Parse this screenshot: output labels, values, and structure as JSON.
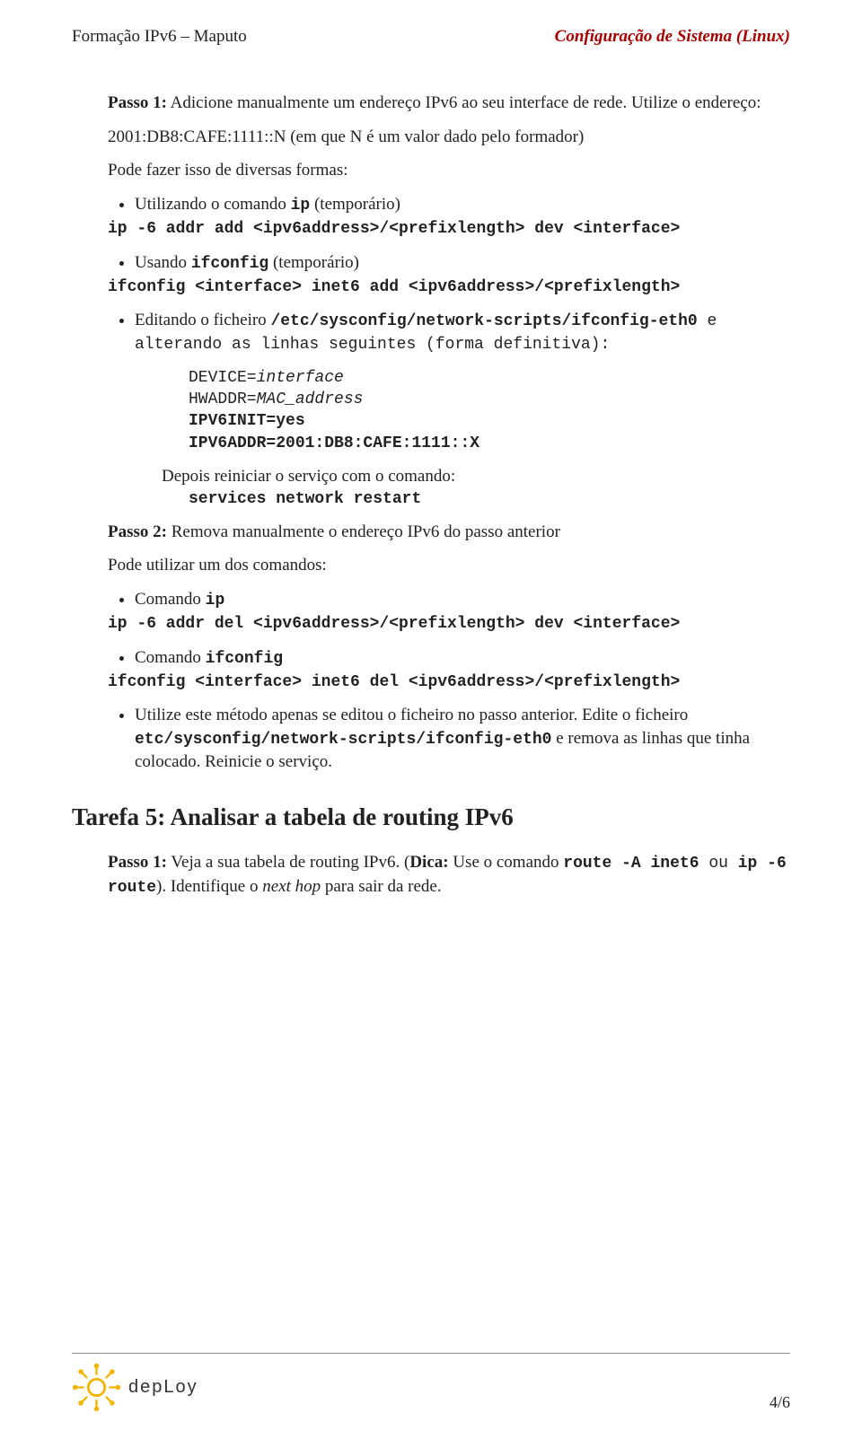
{
  "header": {
    "left": "Formação IPv6 – Maputo",
    "right": "Configuração de Sistema (Linux)"
  },
  "passo1": {
    "label": "Passo 1:",
    "title": " Adicione manualmente um endereço IPv6 ao seu interface de rede. Utilize o endereço:",
    "addr_line": "2001:DB8:CAFE:1111::N (em que N é um valor dado pelo formador)",
    "pode": "Pode fazer isso de diversas formas:",
    "b1_text_a": "Utilizando o comando ",
    "b1_code": "ip",
    "b1_text_b": " (temporário)",
    "b1_cmd": "ip -6 addr add <ipv6address>/<prefixlength> dev <interface>",
    "b2_text_a": "Usando ",
    "b2_code": "ifconfig",
    "b2_text_b": " (temporário)",
    "b2_cmd": "ifconfig <interface> inet6 add <ipv6address>/<prefixlength>",
    "b3_text_a": "Editando o ficheiro ",
    "b3_code": "/etc/sysconfig/network-scripts/ifconfig-eth0",
    "b3_text_b": " e alterando as linhas seguintes (forma definitiva):",
    "cb_l1a": "DEVICE=",
    "cb_l1b": "interface",
    "cb_l2a": "HWADDR=",
    "cb_l2b": "MAC_address",
    "cb_l3": "IPV6INIT=yes",
    "cb_l4": "IPV6ADDR=2001:DB8:CAFE:1111::X",
    "depois": "Depois reiniciar o serviço com o comando:",
    "depois_cmd": "services network restart"
  },
  "passo2": {
    "label": "Passo 2:",
    "title": " Remova manualmente o endereço IPv6 do passo anterior",
    "pode": "Pode utilizar um dos comandos:",
    "b1_text": "Comando ",
    "b1_code": "ip",
    "b1_cmd": "ip -6 addr del <ipv6address>/<prefixlength> dev <interface>",
    "b2_text": "Comando ",
    "b2_code": "ifconfig",
    "b2_cmd": "ifconfig <interface> inet6 del <ipv6address>/<prefixlength>",
    "b3_text_a": "Utilize este método apenas se editou o ficheiro no passo anterior. Edite o ficheiro ",
    "b3_code": "etc/sysconfig/network-scripts/ifconfig-eth0",
    "b3_text_b": " e remova as linhas que tinha colocado. Reinicie o serviço."
  },
  "tarefa5": {
    "title": "Tarefa 5: Analisar a tabela de routing IPv6",
    "p1_label": "Passo 1:",
    "p1_text_a": " Veja a sua tabela de routing IPv6. (",
    "p1_dica": "Dica:",
    "p1_text_b": " Use o comando ",
    "p1_code1": "route -A inet6",
    "p1_ou": " ou ",
    "p1_code2": "ip -6 route",
    "p1_text_c": "). Identifique o ",
    "p1_italic": "next hop",
    "p1_text_d": " para sair da rede."
  },
  "footer": {
    "logo_text": "depLoy",
    "page": "4/6"
  }
}
